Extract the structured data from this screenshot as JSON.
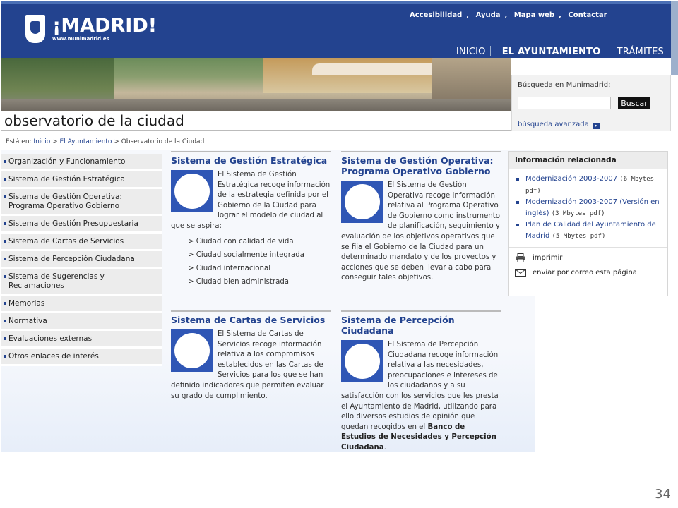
{
  "header": {
    "logo_text": "¡MADRID!",
    "logo_url": "www.munimadrid.es",
    "top_links": [
      "Accesibilidad",
      "Ayuda",
      "Mapa web",
      "Contactar"
    ],
    "nav": [
      "INICIO",
      "EL AYUNTAMIENTO",
      "TRÁMITES"
    ],
    "active_nav": "EL AYUNTAMIENTO"
  },
  "search": {
    "label": "Búsqueda en Munimadrid:",
    "input_value": "",
    "button": "Buscar",
    "advanced_link": "búsqueda avanzada"
  },
  "page": {
    "title": "observatorio de la ciudad",
    "breadcrumb_prefix": "Está en: ",
    "breadcrumb": [
      "Inicio",
      "El Ayuntamiento",
      "Observatorio de la Ciudad"
    ],
    "slide_number": "34"
  },
  "left_menu": [
    "Organización y Funcionamiento",
    "Sistema de Gestión Estratégica",
    "Sistema de Gestión Operativa: Programa Operativo Gobierno",
    "Sistema de Gestión Presupuestaria",
    "Sistema de Cartas de Servicios",
    "Sistema de Percepción Ciudadana",
    "Sistema de Sugerencias y Reclamaciones",
    "Memorias",
    "Normativa",
    "Evaluaciones externas",
    "Otros enlaces de interés"
  ],
  "sections": {
    "estrategica": {
      "title": "Sistema de Gestión Estratégica",
      "text": "El Sistema de Gestión Estratégica recoge información de la estrategia definida por el Gobierno de la Ciudad para lograr el modelo de ciudad al que se aspira:",
      "bullets": [
        "> Ciudad con calidad de vida",
        "> Ciudad socialmente integrada",
        "> Ciudad internacional",
        "> Ciudad bien administrada"
      ]
    },
    "operativa": {
      "title": "Sistema de Gestión Operativa: Programa Operativo Gobierno",
      "text": "El Sistema de Gestión Operativa recoge información relativa al Programa Operativo de Gobierno como instrumento de planificación, seguimiento y evaluación de los objetivos operativos que se fija el Gobierno de la Ciudad para un determinado mandato y de los proyectos y acciones que se deben llevar a cabo para conseguir tales objetivos."
    },
    "cartas": {
      "title": "Sistema de Cartas de Servicios",
      "text": "El Sistema de Cartas de Servicios recoge información relativa a los compromisos establecidos en las Cartas de Servicios para los que se han definido indicadores que permiten evaluar su grado de cumplimiento."
    },
    "percepcion": {
      "title": "Sistema de Percepción Ciudadana",
      "text": "El Sistema de Percepción Ciudadana recoge información relativa a las necesidades, preocupaciones e intereses de los ciudadanos y a su satisfacción con los servicios que les presta el Ayuntamiento de Madrid, utilizando para ello diversos estudios de opinión que quedan recogidos en el",
      "bold_text": "Banco de Estudios de Necesidades y Percepción Ciudadana",
      "end": "."
    }
  },
  "related": {
    "title": "Información relacionada",
    "links": [
      {
        "text": "Modernización 2003-2007",
        "size": "(6 Mbytes pdf)"
      },
      {
        "text": "Modernización 2003-2007 (Versión en inglés)",
        "size": "(3 Mbytes pdf)"
      },
      {
        "text": "Plan de Calidad del Ayuntamiento de Madrid",
        "size": "(5 Mbytes pdf)"
      }
    ],
    "print": "imprimir",
    "email": "enviar por correo esta página"
  },
  "colors": {
    "header_blue": "#23438f",
    "link_blue": "#23438f",
    "menu_bg": "#ececec"
  }
}
